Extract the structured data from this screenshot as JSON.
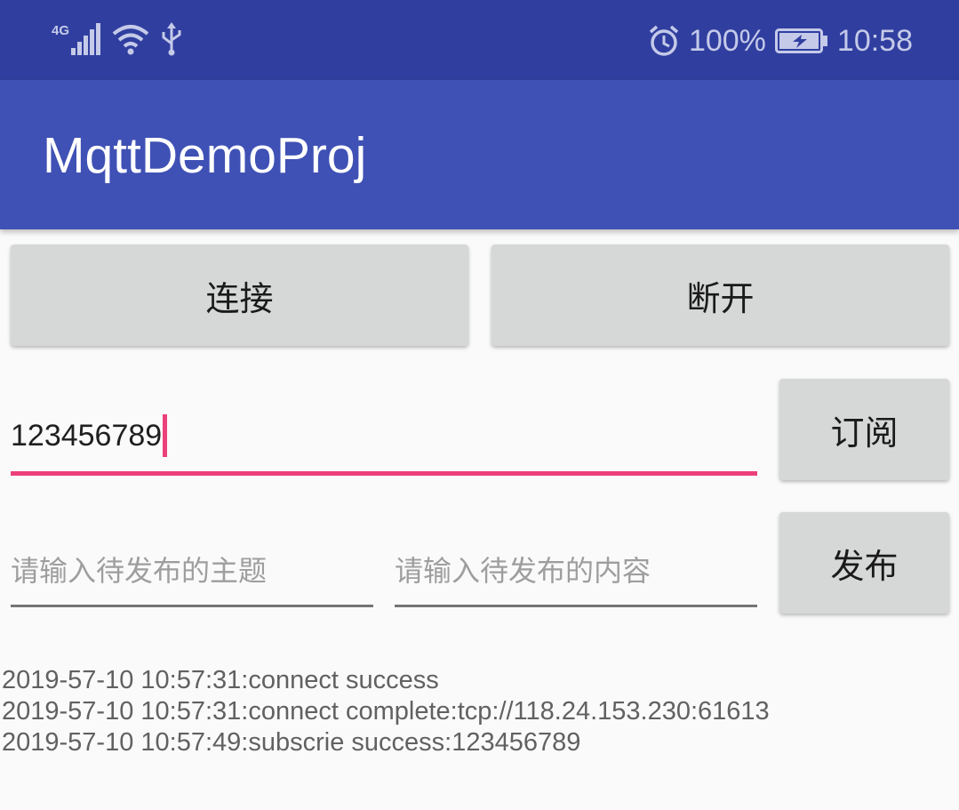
{
  "status_bar": {
    "network": "4G",
    "battery_percent": "100%",
    "time": "10:58",
    "icons": [
      "signal-icon",
      "wifi-icon",
      "usb-icon",
      "alarm-icon",
      "battery-charging-icon"
    ]
  },
  "app_bar": {
    "title": "MqttDemoProj"
  },
  "buttons": {
    "connect": "连接",
    "disconnect": "断开",
    "subscribe": "订阅",
    "publish": "发布"
  },
  "inputs": {
    "subscribe_topic_value": "123456789",
    "publish_topic_placeholder": "请输入待发布的主题",
    "publish_content_placeholder": "请输入待发布的内容"
  },
  "log": [
    "2019-57-10 10:57:31:connect success",
    "2019-57-10 10:57:31:connect complete:tcp://118.24.153.230:61613",
    "2019-57-10 10:57:49:subscrie success:123456789"
  ],
  "colors": {
    "status_bar": "#303f9f",
    "app_bar": "#3f51b5",
    "accent": "#ec407a",
    "button": "#d6d7d7",
    "background": "#fafafa"
  }
}
